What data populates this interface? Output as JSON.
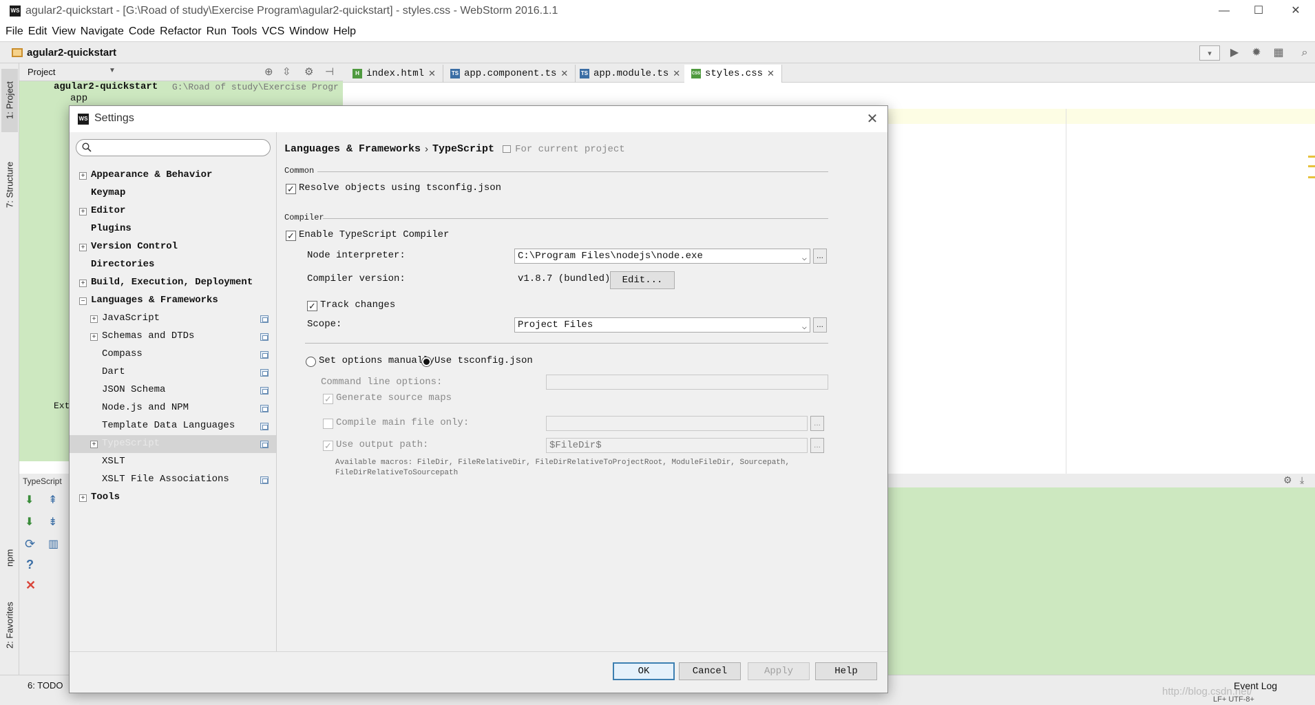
{
  "window": {
    "title": "agular2-quickstart - [G:\\Road of study\\Exercise Program\\agular2-quickstart] - styles.css - WebStorm 2016.1.1",
    "app_icon": "WS",
    "minimize": "—",
    "maximize": "☐",
    "close": "✕"
  },
  "menu": [
    "File",
    "Edit",
    "View",
    "Navigate",
    "Code",
    "Refactor",
    "Run",
    "Tools",
    "VCS",
    "Window",
    "Help"
  ],
  "navbar": {
    "project": "agular2-quickstart"
  },
  "tool_windows": {
    "project": "1: Project",
    "structure": "7: Structure",
    "npm": "npm",
    "favorites": "2: Favorites",
    "todo": "6: TODO",
    "event_log": "Event Log",
    "typescript_panel": "TypeScript"
  },
  "project_panel": {
    "header": "Project",
    "root_name": "agular2-quickstart",
    "root_path": "G:\\Road of study\\Exercise Progr",
    "child_app": "app",
    "external": "Ext"
  },
  "editor_tabs": [
    {
      "label": "index.html",
      "icon": "H",
      "color": "#4f9a3f"
    },
    {
      "label": "app.component.ts",
      "icon": "TS",
      "color": "#3b6ea5"
    },
    {
      "label": "app.module.ts",
      "icon": "TS",
      "color": "#3b6ea5"
    },
    {
      "label": "styles.css",
      "icon": "CSS",
      "color": "#4f9a3f"
    }
  ],
  "status": {
    "watermark": "http://blog.csdn.net/",
    "encoding": "LF+  UTF-8+"
  },
  "dialog": {
    "title": "Settings",
    "icon": "WS",
    "search_placeholder": "",
    "tree": [
      {
        "label": "Appearance & Behavior",
        "bold": true,
        "expander": "+",
        "indent": 0
      },
      {
        "label": "Keymap",
        "bold": true,
        "expander": "",
        "indent": 0
      },
      {
        "label": "Editor",
        "bold": true,
        "expander": "+",
        "indent": 0
      },
      {
        "label": "Plugins",
        "bold": true,
        "expander": "",
        "indent": 0
      },
      {
        "label": "Version Control",
        "bold": true,
        "expander": "+",
        "indent": 0
      },
      {
        "label": "Directories",
        "bold": true,
        "expander": "",
        "indent": 0
      },
      {
        "label": "Build, Execution, Deployment",
        "bold": true,
        "expander": "+",
        "indent": 0
      },
      {
        "label": "Languages & Frameworks",
        "bold": true,
        "expander": "−",
        "indent": 0
      },
      {
        "label": "JavaScript",
        "bold": false,
        "expander": "+",
        "indent": 1,
        "proj": true
      },
      {
        "label": "Schemas and DTDs",
        "bold": false,
        "expander": "+",
        "indent": 1,
        "proj": true
      },
      {
        "label": "Compass",
        "bold": false,
        "expander": "",
        "indent": 1,
        "proj": true
      },
      {
        "label": "Dart",
        "bold": false,
        "expander": "",
        "indent": 1,
        "proj": true
      },
      {
        "label": "JSON Schema",
        "bold": false,
        "expander": "",
        "indent": 1,
        "proj": true
      },
      {
        "label": "Node.js and NPM",
        "bold": false,
        "expander": "",
        "indent": 1,
        "proj": true
      },
      {
        "label": "Template Data Languages",
        "bold": false,
        "expander": "",
        "indent": 1,
        "proj": true
      },
      {
        "label": "TypeScript",
        "bold": false,
        "expander": "+",
        "indent": 1,
        "proj": true,
        "selected": true
      },
      {
        "label": "XSLT",
        "bold": false,
        "expander": "",
        "indent": 1
      },
      {
        "label": "XSLT File Associations",
        "bold": false,
        "expander": "",
        "indent": 1,
        "proj": true
      },
      {
        "label": "Tools",
        "bold": true,
        "expander": "+",
        "indent": 0
      }
    ],
    "breadcrumb": {
      "parent": "Languages & Frameworks",
      "sep": "›",
      "current": "TypeScript",
      "note": "For current project"
    },
    "common": {
      "header": "Common",
      "resolve_label": "Resolve objects using tsconfig.json",
      "resolve_checked": true
    },
    "compiler": {
      "header": "Compiler",
      "enable_label": "Enable TypeScript Compiler",
      "enable_checked": true,
      "node_label": "Node interpreter:",
      "node_value": "C:\\Program Files\\nodejs\\node.exe",
      "version_label": "Compiler version:",
      "version_value": "v1.8.7 (bundled)",
      "edit_button": "Edit...",
      "track_label": "Track changes",
      "track_checked": true,
      "scope_label": "Scope:",
      "scope_value": "Project Files",
      "set_manually_label": "Set options manually",
      "use_tsconfig_label": "Use tsconfig.json",
      "selected_option": "use_tsconfig",
      "cmd_label": "Command line options:",
      "cmd_value": "",
      "gen_maps_label": "Generate source maps",
      "compile_main_label": "Compile main file only:",
      "compile_main_value": "",
      "output_label": "Use output path:",
      "output_value": "$FileDir$",
      "macros_line1": "Available macros: FileDir, FileRelativeDir, FileDirRelativeToProjectRoot, ModuleFileDir, Sourcepath,",
      "macros_line2": "FileDirRelativeToSourcepath"
    },
    "buttons": {
      "ok": "OK",
      "cancel": "Cancel",
      "apply": "Apply",
      "help": "Help"
    },
    "browse": "...",
    "check": "✓",
    "combo_arrow": "⌵"
  },
  "colors": {
    "accent": "#3c7fb1",
    "project_green": "#cde8c0",
    "selection": "#d4d4d4"
  }
}
